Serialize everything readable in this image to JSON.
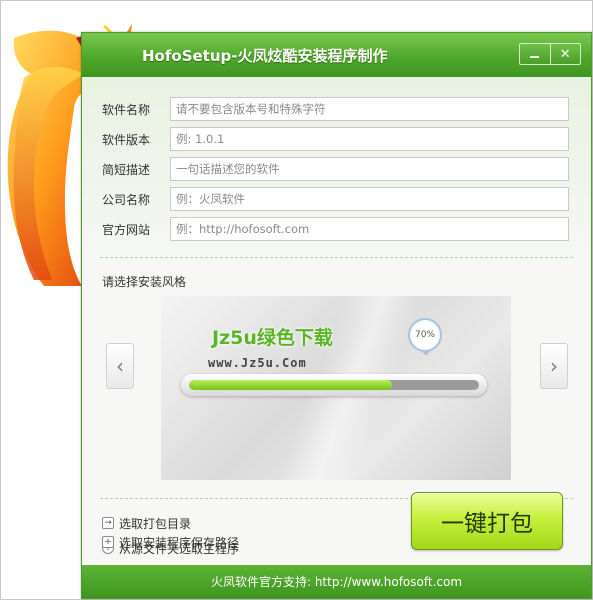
{
  "window": {
    "title": "HofoSetup-火凤炫酷安装程序制作",
    "controls": {
      "minimize": "minimize",
      "close": "✕"
    }
  },
  "form": {
    "fields": [
      {
        "label": "软件名称",
        "placeholder": "请不要包含版本号和特殊字符"
      },
      {
        "label": "软件版本",
        "placeholder": "例: 1.0.1"
      },
      {
        "label": "简短描述",
        "placeholder": "一句话描述您的软件"
      },
      {
        "label": "公司名称",
        "placeholder": "例：火凤软件"
      },
      {
        "label": "官方网站",
        "placeholder": "例：http://hofosoft.com"
      }
    ]
  },
  "style_section": {
    "label": "请选择安装风格",
    "prev": "‹",
    "next": "›",
    "preview": {
      "progress_text": "70%",
      "progress_value": 0.7
    },
    "watermark": {
      "name": "Jz5u绿色下载",
      "url": "www.Jz5u.Com"
    }
  },
  "actions": [
    {
      "label": "选取打包目录",
      "icon": "folder-arrow-icon"
    },
    {
      "label": "从源文件夹选取主程序",
      "icon": "plus-circle-icon"
    },
    {
      "label": "选取安装程序保存路径",
      "icon": "plus-box-icon"
    }
  ],
  "pack_button": "一键打包",
  "footer": "火凤软件官方支持: http://www.hofosoft.com",
  "colors": {
    "title_green": "#4fa82b",
    "button_lime": "#c6ef3c",
    "progress_fill": "#79c21a"
  }
}
